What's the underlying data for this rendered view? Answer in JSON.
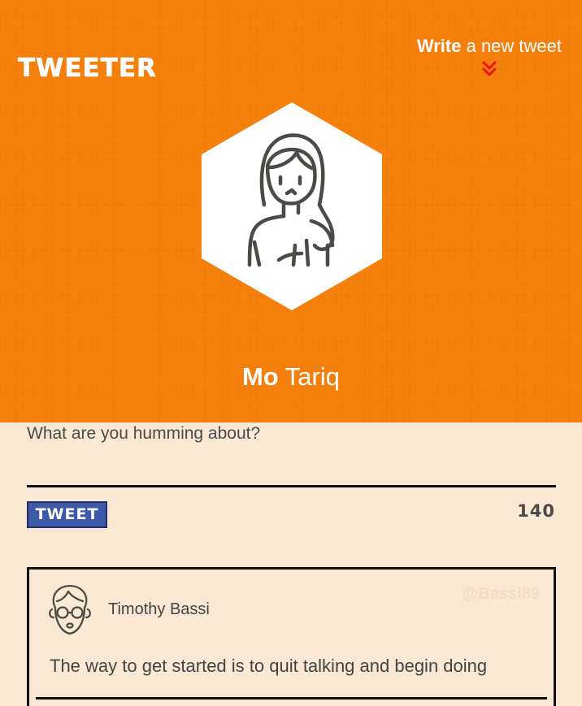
{
  "header": {
    "logo": "TWEETER",
    "write_link": {
      "strong": "Write",
      "rest": " a new tweet"
    },
    "arrow_icon": "double-chevron-down",
    "accent_color": "#f47f0b",
    "arrow_color": "#e8140c"
  },
  "profile": {
    "first_name": "Mo",
    "last_name": " Tariq",
    "avatar_icon": "woman-avatar"
  },
  "compose": {
    "placeholder": "What are you humming about?",
    "button_label": "TWEET",
    "counter": "140"
  },
  "tweets": [
    {
      "author": "Timothy Bassi",
      "handle": "@Bassi89",
      "text": "The way to get started is to quit talking and begin doing",
      "avatar_icon": "man-glasses-avatar"
    }
  ]
}
